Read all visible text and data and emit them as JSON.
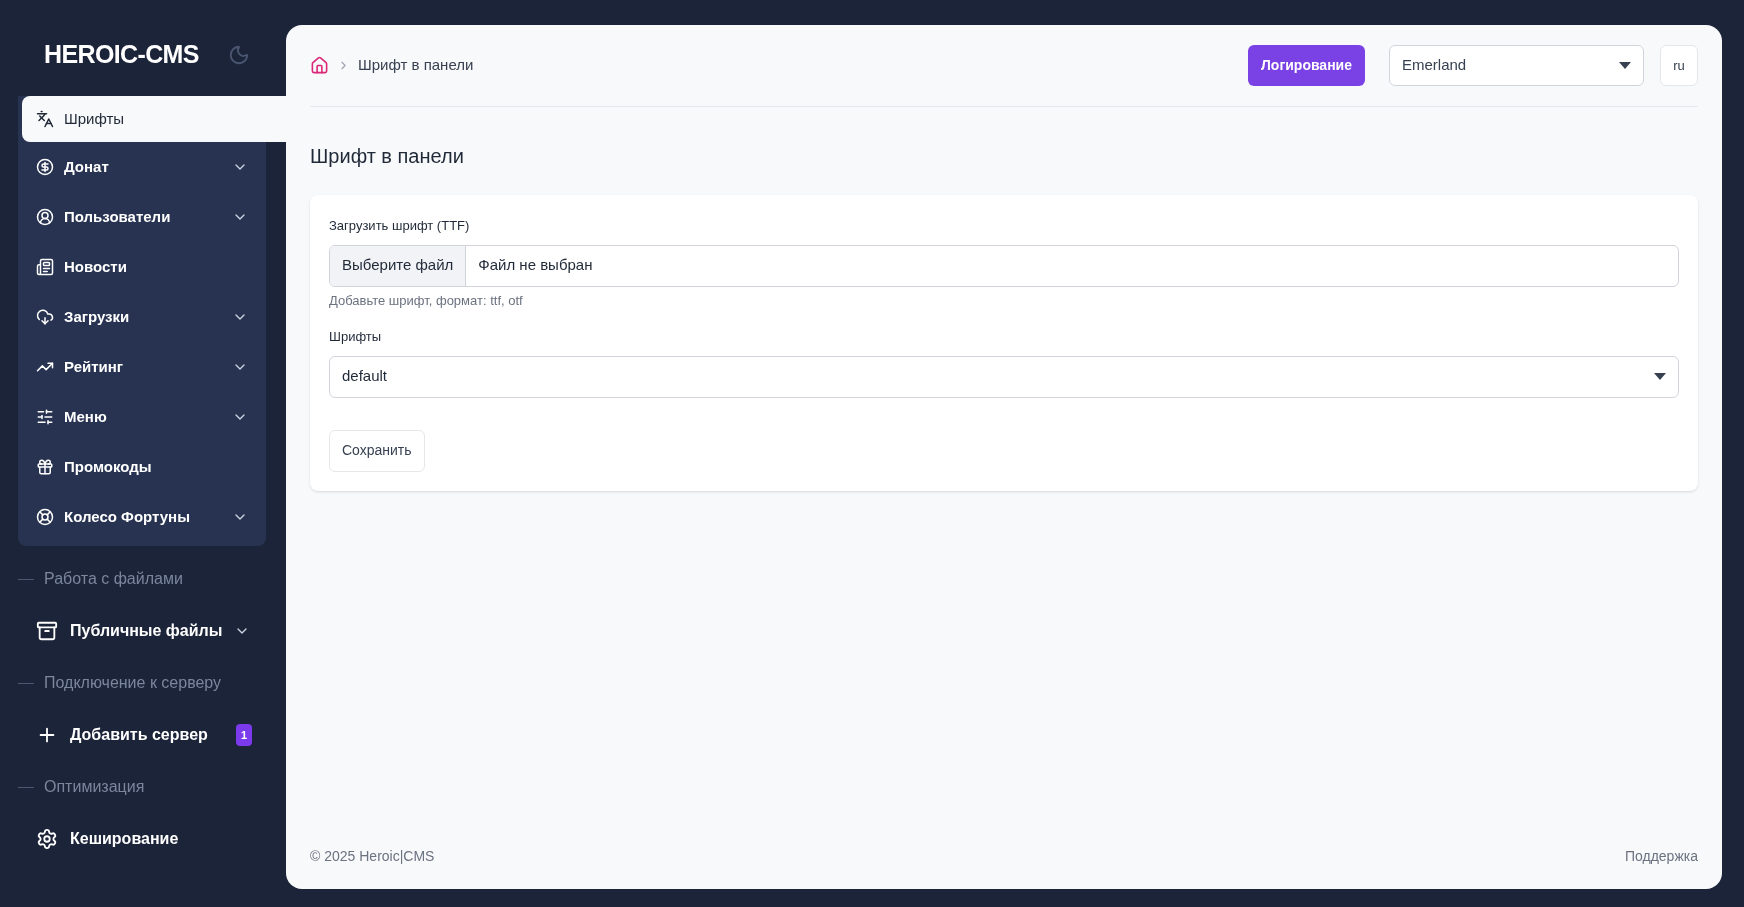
{
  "sidebar": {
    "logo": "HEROIC-CMS",
    "items": [
      {
        "label": "Шрифты",
        "selected": true,
        "expandable": false
      },
      {
        "label": "Донат",
        "selected": false,
        "expandable": true
      },
      {
        "label": "Пользователи",
        "selected": false,
        "expandable": true
      },
      {
        "label": "Новости",
        "selected": false,
        "expandable": false
      },
      {
        "label": "Загрузки",
        "selected": false,
        "expandable": true
      },
      {
        "label": "Рейтинг",
        "selected": false,
        "expandable": true
      },
      {
        "label": "Меню",
        "selected": false,
        "expandable": true
      },
      {
        "label": "Промокоды",
        "selected": false,
        "expandable": false
      },
      {
        "label": "Колесо Фортуны",
        "selected": false,
        "expandable": true
      }
    ],
    "sections": [
      {
        "title": "Работа с файлами",
        "items": [
          {
            "label": "Публичные файлы",
            "expandable": true
          }
        ]
      },
      {
        "title": "Подключение к серверу",
        "items": [
          {
            "label": "Добавить сервер",
            "expandable": false,
            "badge": "1"
          }
        ]
      },
      {
        "title": "Оптимизация",
        "items": [
          {
            "label": "Кеширование",
            "expandable": false
          }
        ]
      }
    ]
  },
  "header": {
    "breadcrumb": "Шрифт в панели",
    "log_button": "Логирование",
    "server_select": "Emerland",
    "language": "ru"
  },
  "page": {
    "title": "Шрифт в панели",
    "upload": {
      "label": "Загрузить шрифт (TTF)",
      "button": "Выберите файл",
      "value": "Файл не выбран",
      "hint": "Добавьте шрифт, формат: ttf, otf"
    },
    "fonts": {
      "label": "Шрифты",
      "value": "default"
    },
    "save_button": "Сохранить"
  },
  "footer": {
    "copyright": "© 2025 Heroic|CMS",
    "support": "Поддержка"
  }
}
